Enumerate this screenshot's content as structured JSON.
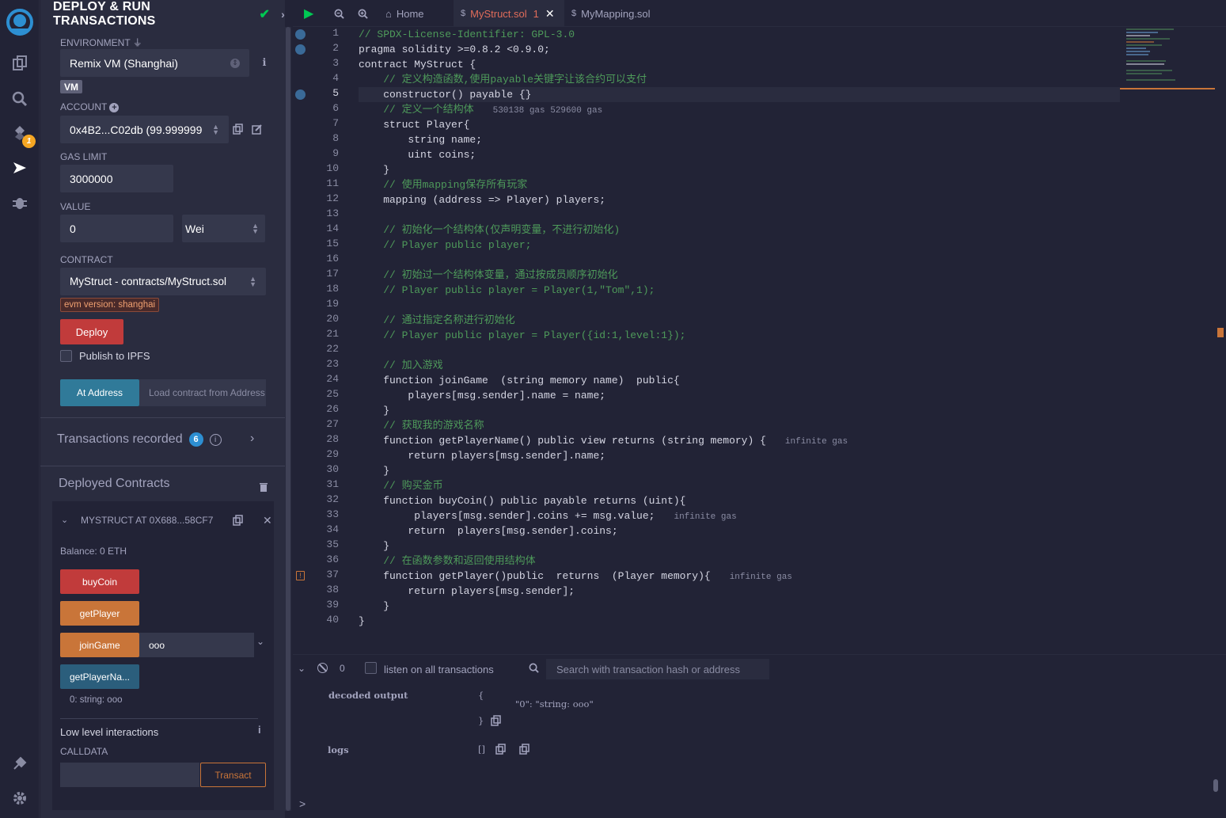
{
  "side_panel": {
    "title": "DEPLOY & RUN TRANSACTIONS",
    "environment_label": "ENVIRONMENT",
    "environment_value": "Remix VM (Shanghai)",
    "vm_badge": "VM",
    "account_label": "ACCOUNT",
    "account_value": "0x4B2...C02db (99.999999",
    "gas_limit_label": "GAS LIMIT",
    "gas_limit_value": "3000000",
    "value_label": "VALUE",
    "value_amount": "0",
    "value_unit": "Wei",
    "contract_label": "CONTRACT",
    "contract_value": "MyStruct - contracts/MyStruct.sol",
    "evm_badge": "evm version: shanghai",
    "deploy_label": "Deploy",
    "publish_ipfs_label": "Publish to IPFS",
    "at_address_label": "At Address",
    "load_contract_placeholder": "Load contract from Address",
    "transactions_recorded_label": "Transactions recorded",
    "transactions_recorded_count": "6",
    "deployed_contracts_label": "Deployed Contracts",
    "instance_title": "MYSTRUCT AT 0X688...58CF7",
    "balance": "Balance: 0 ETH",
    "functions": [
      {
        "label": "buyCoin"
      },
      {
        "label": "getPlayer"
      },
      {
        "label": "joinGame",
        "input_value": "ooo"
      },
      {
        "label": "getPlayerNa..."
      }
    ],
    "call_result": "0: string: ooo",
    "low_level_label": "Low level interactions",
    "calldata_label": "CALLDATA",
    "transact_label": "Transact"
  },
  "editor": {
    "tabs": [
      {
        "label": "Home"
      },
      {
        "label": "MyStruct.sol",
        "count": "1"
      },
      {
        "label": "MyMapping.sol"
      }
    ],
    "breakpoint_lines": [
      1,
      2,
      5
    ],
    "warning_line": 37,
    "current_line": 5,
    "lines": [
      "// SPDX-License-Identifier: GPL-3.0",
      "pragma solidity >=0.8.2 <0.9.0;",
      "contract MyStruct {",
      "    // 定义构造函数,使用payable关键字让该合约可以支付",
      "    constructor() payable {}",
      "    // 定义一个结构体",
      "    struct Player{",
      "        string name;",
      "        uint coins;",
      "    }",
      "    // 使用mapping保存所有玩家",
      "    mapping (address => Player) players;",
      "",
      "    // 初始化一个结构体(仅声明变量，不进行初始化)",
      "    // Player public player;",
      "",
      "    // 初始过一个结构体变量，通过按成员顺序初始化",
      "    // Player public player = Player(1,\"Tom\",1);",
      "",
      "    // 通过指定名称进行初始化",
      "    // Player public player = Player({id:1,level:1});",
      "",
      "    // 加入游戏",
      "    function joinGame  (string memory name)  public{",
      "        players[msg.sender].name = name;",
      "    }",
      "    // 获取我的游戏名称",
      "    function getPlayerName() public view returns (string memory) {",
      "        return players[msg.sender].name;",
      "    }",
      "    // 购买金币",
      "    function buyCoin() public payable returns (uint){",
      "         players[msg.sender].coins += msg.value;",
      "        return  players[msg.sender].coins;",
      "    }",
      "    // 在函数参数和返回使用结构体",
      "    function getPlayer()public  returns  (Player memory){",
      "        return players[msg.sender];",
      "    }",
      "}"
    ],
    "gas_hints": [
      {
        "line": 6,
        "text": "530138 gas 529600 gas"
      },
      {
        "line": 28,
        "text": "infinite gas"
      },
      {
        "line": 33,
        "text": "infinite gas"
      },
      {
        "line": 37,
        "text": "infinite gas"
      }
    ]
  },
  "terminal": {
    "pending_count": "0",
    "listen_label": "listen on all transactions",
    "search_placeholder": "Search with transaction hash or address",
    "decoded_output_label": "decoded output",
    "brace_open": "{",
    "decoded_value": "\"0\": \"string: ooo\"",
    "brace_close": "}",
    "logs_label": "logs",
    "logs_value": "[]",
    "prompt": ">"
  },
  "colors": {
    "accent_green": "#00c853",
    "deploy_red": "#c13b3b",
    "payable_orange": "#c97539",
    "call_blue": "#2b5e7c"
  }
}
